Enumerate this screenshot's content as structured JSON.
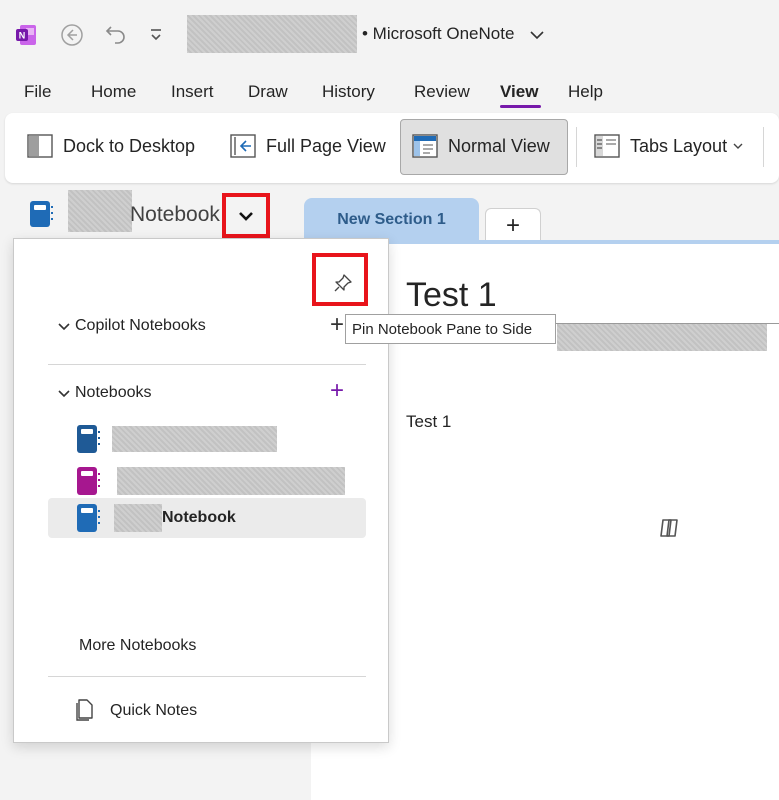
{
  "titlebar": {
    "app_name": "• Microsoft OneNote",
    "icons": [
      "onenote-logo-icon",
      "back-icon",
      "undo-icon",
      "customize-qat-icon",
      "chevron-down-icon"
    ]
  },
  "menu": {
    "items": [
      "File",
      "Home",
      "Insert",
      "Draw",
      "History",
      "Review",
      "View",
      "Help"
    ],
    "active": "View",
    "accent": "#7719aa"
  },
  "ribbon": {
    "dock": "Dock to Desktop",
    "full_page": "Full Page View",
    "normal": "Normal View",
    "tabs_layout": "Tabs Layout"
  },
  "notebook_header": {
    "label": "Notebook"
  },
  "section_tabs": {
    "active": "New Section 1",
    "add": "+"
  },
  "flyout": {
    "copilot_header": "Copilot Notebooks",
    "notebooks_header": "Notebooks",
    "add_symbol": "+",
    "notebook_items": [
      {
        "label": "",
        "color": "#1f5a96"
      },
      {
        "label": "",
        "color": "#a6178f"
      },
      {
        "label": "Notebook",
        "color": "#1f6bb6",
        "selected": true
      }
    ],
    "more_notebooks": "More Notebooks",
    "quick_notes": "Quick Notes"
  },
  "tooltip": {
    "text": "Pin Notebook Pane to Side"
  },
  "page": {
    "title": "Test 1",
    "body": "Test 1"
  }
}
